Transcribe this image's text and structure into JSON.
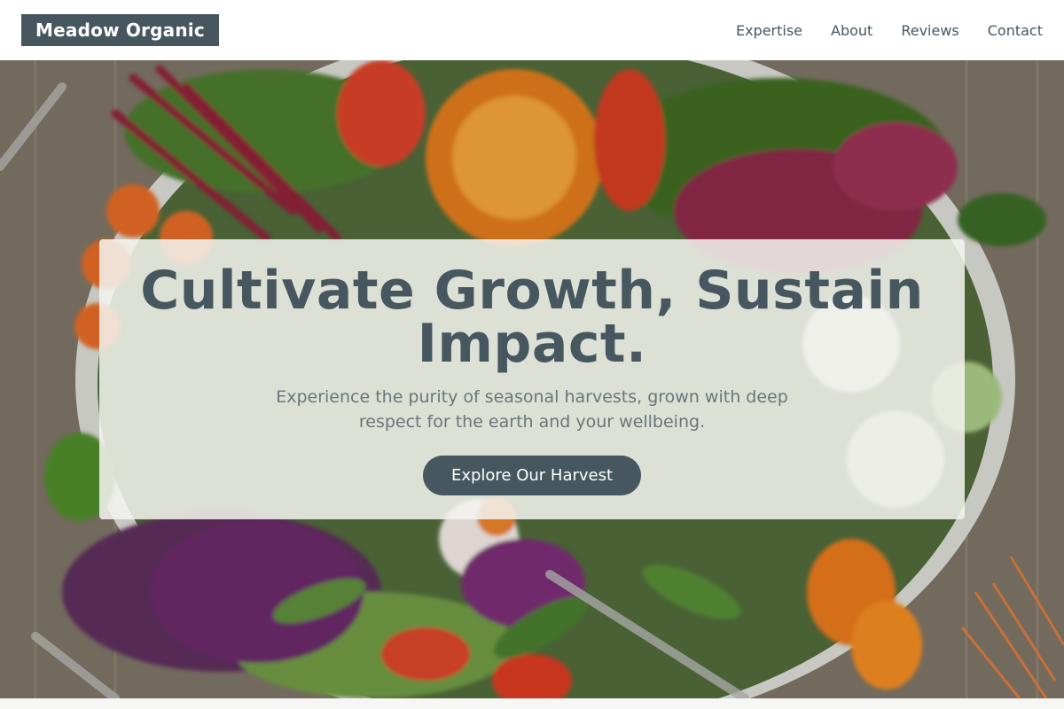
{
  "header": {
    "logo": "Meadow Organic",
    "nav": [
      {
        "label": "Expertise"
      },
      {
        "label": "About"
      },
      {
        "label": "Reviews"
      },
      {
        "label": "Contact"
      }
    ]
  },
  "hero": {
    "title": "Cultivate Growth, Sustain Impact.",
    "subtitle": "Experience the purity of seasonal harvests, grown with deep respect for the earth and your wellbeing.",
    "cta_label": "Explore Our Harvest"
  },
  "colors": {
    "brand_dark": "#46575f",
    "overlay": "#f4f4f0",
    "text_muted": "#6b767c"
  }
}
